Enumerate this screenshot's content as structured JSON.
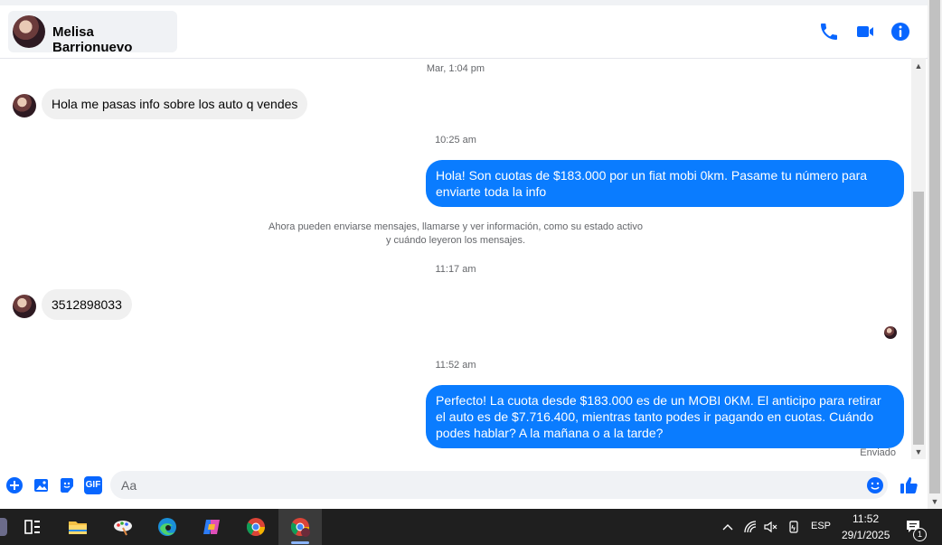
{
  "header": {
    "contact_name": "Melisa Barrionuevo",
    "icons": [
      "phone-icon",
      "video-icon",
      "info-icon"
    ]
  },
  "conversation": {
    "ts1": "Mar, 1:04 pm",
    "msg1": "Hola me pasas info sobre los auto q vendes",
    "ts2": "10:25 am",
    "msg2": "Hola! Son cuotas de $183.000 por un fiat mobi 0km. Pasame tu número para enviarte toda la info",
    "notice_line1": "Ahora pueden enviarse mensajes, llamarse y ver información, como su estado activo",
    "notice_line2": "y cuándo leyeron los mensajes.",
    "ts3": "11:17 am",
    "msg3": "3512898033",
    "ts4": "11:52 am",
    "msg4": "Perfecto! La cuota desde $183.000 es de un MOBI 0KM. El anticipo para retirar el auto es de $7.716.400, mientras tanto podes ir pagando en cuotas. Cuándo podes hablar? A la mañana o a la tarde?",
    "status": "Enviado"
  },
  "composer": {
    "placeholder": "Aa",
    "icons": [
      "plus-icon",
      "gallery-icon",
      "sticker-icon",
      "gif-icon",
      "emoji-icon",
      "like-icon"
    ],
    "gif_label": "GIF"
  },
  "taskbar": {
    "time": "11:52",
    "date": "29/1/2025",
    "language": "ESP",
    "notification_count": "1",
    "apps": [
      "widgets-icon",
      "file-explorer-icon",
      "paint-icon",
      "edge-icon",
      "copilot-icon",
      "chrome-icon",
      "chrome-profile-icon"
    ]
  },
  "colors": {
    "accent": "#0866ff",
    "bubble_out": "#0a7cff",
    "bubble_in": "#f0f0f0"
  }
}
